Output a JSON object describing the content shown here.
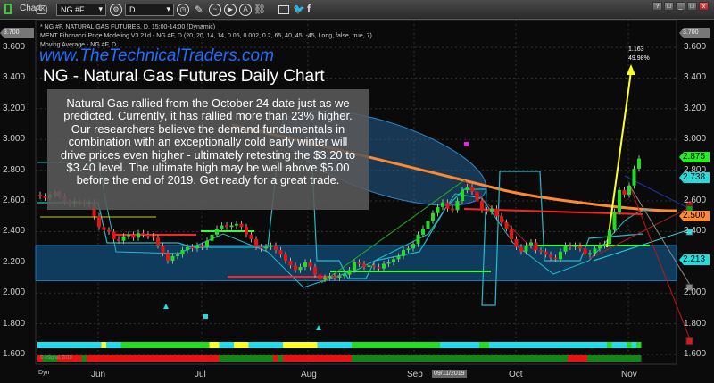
{
  "window": {
    "app_label": "Chart",
    "badge": "4K",
    "symbol": "NG #F",
    "interval": "D",
    "controls": [
      "?",
      "□",
      "_",
      "□",
      "x"
    ]
  },
  "legend": {
    "line1": "* NG #F, NATURAL GAS FUTURES, D, 15:00-14:00 (Dynamic)",
    "line2": "MENT Fibonacci Price Modeling V3.21d - NG #F, D (20, 20, 14, 14, 0.05, 0.002, 0.2, 65, 40, 45, -45, Long, false, true, 7)",
    "line3": "Moving Average - NG #F, D"
  },
  "watermark": "www.TheTechnicalTraders.com",
  "note": "Natural Gas rallied from the October 24 date just as we predicted.  Currently, it has rallied more than 23% higher.  Our researchers believe the demand fundamentals in combination with an exceptionally cold early winter will drive prices even higher - ultimately retesting the $3.20 to $3.40 level.  The ultimate high may be well above $5.00 before the end of 2019.  Get ready for a great trade.",
  "annotation": {
    "value": "1.163",
    "percent": "49.98%"
  },
  "copyright": "© eSignal, 2019",
  "footer": {
    "dyn": "Dyn",
    "date_badge": "09/11/2019"
  },
  "price_tags": {
    "last": "2.875",
    "cyan_upper": "2.738",
    "moving_average": "2.500",
    "cyan_lower": "2.213",
    "top_marker": "3.700"
  },
  "colors": {
    "up": "#22dd22",
    "down": "#ee1111",
    "ma": "#ff8833",
    "cyan": "#22dddd",
    "band": "#0f3b5c",
    "yellow": "#ffff22"
  },
  "chart_data": {
    "type": "candlestick",
    "title": "NG - Natural Gas Futures Daily Chart",
    "ylim": [
      1.55,
      3.75
    ],
    "y_ticks": [
      "3.600",
      "3.400",
      "3.200",
      "3.000",
      "2.800",
      "2.600",
      "2.400",
      "2.200",
      "2.000",
      "1.800",
      "1.600"
    ],
    "x_labels": [
      "Jun",
      "Jul",
      "Aug",
      "Sep",
      "Oct",
      "Nov"
    ],
    "closes": [
      2.63,
      2.62,
      2.64,
      2.65,
      2.63,
      2.59,
      2.58,
      2.6,
      2.59,
      2.58,
      2.59,
      2.5,
      2.43,
      2.41,
      2.4,
      2.35,
      2.34,
      2.37,
      2.38,
      2.36,
      2.39,
      2.38,
      2.37,
      2.36,
      2.31,
      2.26,
      2.21,
      2.24,
      2.25,
      2.28,
      2.3,
      2.29,
      2.31,
      2.3,
      2.34,
      2.38,
      2.42,
      2.44,
      2.43,
      2.44,
      2.45,
      2.43,
      2.38,
      2.35,
      2.3,
      2.29,
      2.3,
      2.31,
      2.28,
      2.25,
      2.21,
      2.18,
      2.15,
      2.17,
      2.2,
      2.17,
      2.12,
      2.09,
      2.1,
      2.11,
      2.1,
      2.11,
      2.12,
      2.15,
      2.2,
      2.19,
      2.17,
      2.18,
      2.17,
      2.16,
      2.19,
      2.2,
      2.22,
      2.24,
      2.28,
      2.29,
      2.32,
      2.38,
      2.42,
      2.47,
      2.52,
      2.56,
      2.59,
      2.55,
      2.54,
      2.6,
      2.67,
      2.69,
      2.66,
      2.6,
      2.54,
      2.53,
      2.55,
      2.5,
      2.46,
      2.42,
      2.35,
      2.3,
      2.27,
      2.31,
      2.33,
      2.28,
      2.27,
      2.25,
      2.23,
      2.22,
      2.27,
      2.31,
      2.3,
      2.31,
      2.29,
      2.25,
      2.26,
      2.29,
      2.31,
      2.32,
      2.41,
      2.53,
      2.67,
      2.64,
      2.7,
      2.81,
      2.875
    ],
    "signal_bar_top": [
      [
        0,
        13,
        "c"
      ],
      [
        13,
        14,
        "y"
      ],
      [
        14,
        17,
        "c"
      ],
      [
        17,
        35,
        "g"
      ],
      [
        35,
        37,
        "y"
      ],
      [
        37,
        40,
        "c"
      ],
      [
        40,
        43,
        "y"
      ],
      [
        43,
        50,
        "c"
      ],
      [
        50,
        57,
        "y"
      ],
      [
        57,
        64,
        "c"
      ],
      [
        64,
        82,
        "g"
      ],
      [
        82,
        90,
        "c"
      ],
      [
        90,
        92,
        "g"
      ],
      [
        92,
        116,
        "c"
      ],
      [
        116,
        117,
        "g"
      ],
      [
        117,
        120,
        "c"
      ],
      [
        120,
        121,
        "g"
      ],
      [
        121,
        122,
        "c"
      ],
      [
        122,
        123,
        "g"
      ]
    ],
    "signal_bar_bottom": [
      [
        0,
        1,
        "r"
      ],
      [
        1,
        4,
        "g"
      ],
      [
        4,
        9,
        "r"
      ],
      [
        9,
        10,
        "g"
      ],
      [
        10,
        37,
        "r"
      ],
      [
        37,
        48,
        "g"
      ],
      [
        48,
        49,
        "r"
      ],
      [
        49,
        50,
        "g"
      ],
      [
        50,
        64,
        "r"
      ],
      [
        64,
        108,
        "g"
      ],
      [
        108,
        112,
        "r"
      ],
      [
        112,
        123,
        "g"
      ]
    ],
    "support_band": [
      2.08,
      2.31
    ],
    "target_markers": [
      {
        "price": 2.58,
        "color": "#aa1111"
      },
      {
        "price": 2.55,
        "color": "#119911"
      },
      {
        "price": 2.4,
        "color": "#22dddd"
      },
      {
        "price": 2.04,
        "color": "#888888"
      },
      {
        "price": 1.69,
        "color": "#ee1111"
      }
    ]
  }
}
